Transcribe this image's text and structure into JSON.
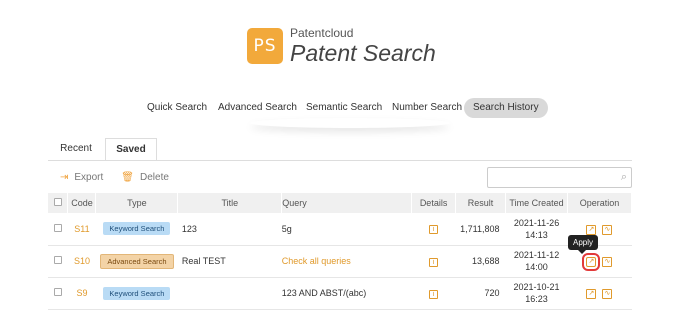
{
  "logo": {
    "mark": "PS",
    "brand": "Patentcloud",
    "title": "Patent Search"
  },
  "nav": [
    "Quick Search",
    "Advanced Search",
    "Semantic Search",
    "Number Search",
    "Search History"
  ],
  "tabs": [
    "Recent",
    "Saved"
  ],
  "toolbar": {
    "export": "Export",
    "delete": "Delete"
  },
  "search": {
    "placeholder": ""
  },
  "table": {
    "headers": [
      "Code",
      "Type",
      "Title",
      "Query",
      "Details",
      "Result",
      "Time Created",
      "Operation"
    ],
    "rows": [
      {
        "code": "S11",
        "type": "Keyword Search",
        "title": "123",
        "query": "5g",
        "result": "1,711,808",
        "date": "2021-11-26",
        "time": "14:13"
      },
      {
        "code": "S10",
        "type": "Advanced Search",
        "title": "Real TEST",
        "query": "Check all queries",
        "result": "13,688",
        "date": "2021-11-12",
        "time": "14:00"
      },
      {
        "code": "S9",
        "type": "Keyword Search",
        "title": "",
        "query": "123 AND ABST/(abc)",
        "result": "720",
        "date": "2021-10-21",
        "time": "16:23"
      }
    ]
  },
  "tooltip": "Apply",
  "colors": {
    "accent": "#f2a93b",
    "link": "#e09a2c",
    "highlight": "#e23a3a",
    "keyword_badge": "#b9dbf5",
    "advanced_badge": "#f3d3a6"
  }
}
